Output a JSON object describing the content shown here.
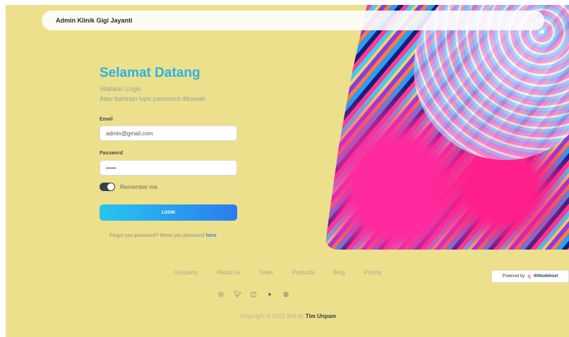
{
  "header": {
    "brand": "Admin Klinik Gigi Jayanti"
  },
  "login": {
    "title": "Selamat Datang",
    "subtitle_1": "Silahkan Login",
    "subtitle_2": "Atau bantuan lupa password dibawah",
    "email_label": "Email",
    "email_value": "admin@gmail.com",
    "password_label": "Password",
    "password_value": "•••••",
    "remember_label": "Remember me",
    "remember_checked": true,
    "button_label": "LOGIN",
    "forgot_text": "Forgot you password? Reset you password",
    "forgot_link": "here"
  },
  "footer": {
    "nav": [
      "Company",
      "About Us",
      "Team",
      "Products",
      "Blog",
      "Pricing"
    ],
    "social_icons": [
      "dribbble-icon",
      "twitter-icon",
      "instagram-icon",
      "pinterest-icon",
      "github-icon"
    ],
    "copyright_prefix": "Copyright © 2023 Soft by",
    "copyright_author": "Tim Unpam"
  },
  "badge": {
    "powered_by": "Powered by",
    "host": "000webhost"
  },
  "colors": {
    "page_bg": "#ece08c",
    "accent": "#2ab1e6",
    "button_start": "#27c6ee",
    "button_end": "#2b7cf0"
  }
}
